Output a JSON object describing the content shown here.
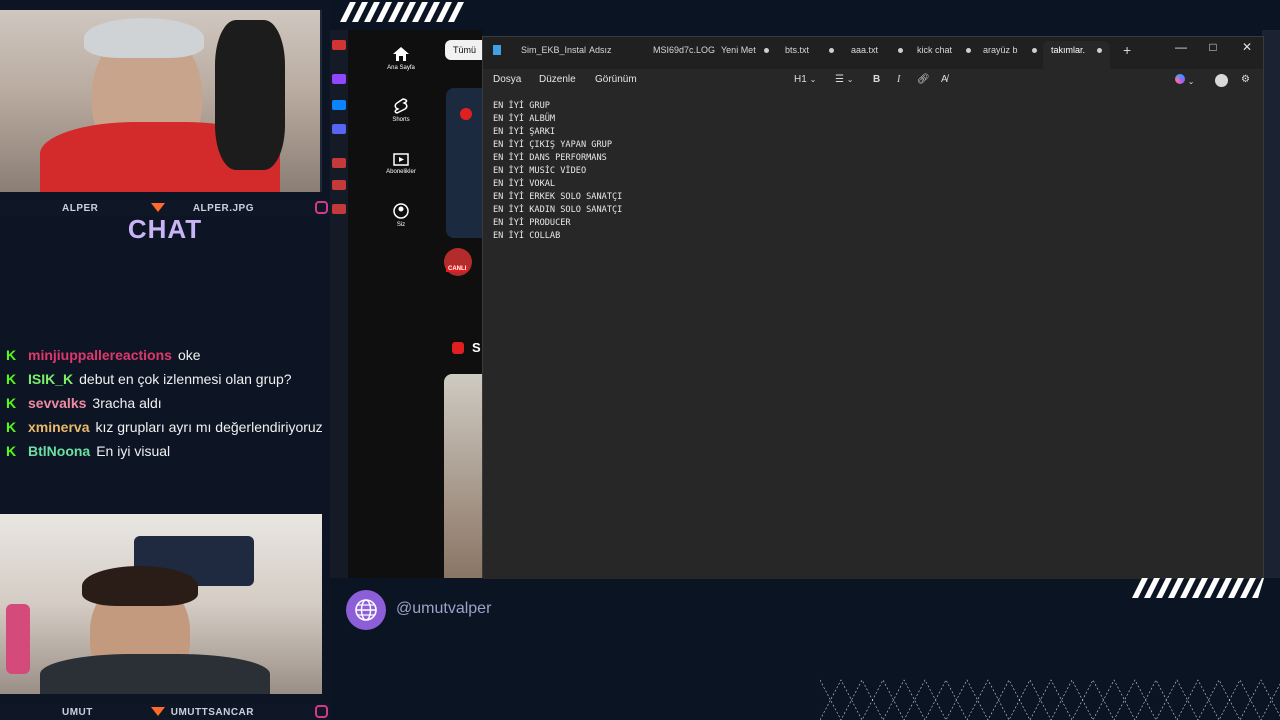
{
  "top_cam": {
    "left_name": "ALPER",
    "right_name": "ALPER.JPG"
  },
  "bottom_cam": {
    "left_name": "UMUT",
    "right_name": "UMUTTSANCAR"
  },
  "chat": {
    "title": "CHAT",
    "messages": [
      {
        "user": "minjiuppallereactions",
        "user_color": "#e0376b",
        "text": "oke"
      },
      {
        "user": "ISIK_K",
        "user_color": "#7bf06b",
        "text": "debut en çok izlenmesi olan grup?"
      },
      {
        "user": "sevvalks",
        "user_color": "#f08aa2",
        "text": "3racha aldı"
      },
      {
        "user": "xminerva",
        "user_color": "#e9b96a",
        "text": "kız grupları ayrı mı değerlendiriyoruz"
      },
      {
        "user": "BtlNoona",
        "user_color": "#6be0a4",
        "text": "En iyi visual"
      }
    ]
  },
  "youtube": {
    "chip": "Tümü",
    "nav": [
      {
        "label": "Ana Sayfa",
        "icon": "home-icon"
      },
      {
        "label": "Shorts",
        "icon": "shorts-icon"
      },
      {
        "label": "Abonelikler",
        "icon": "subscriptions-icon"
      },
      {
        "label": "Siz",
        "icon": "account-icon"
      }
    ],
    "live_badge": "CANLI",
    "section_letter": "S"
  },
  "notepad": {
    "tabs": [
      {
        "label": "Sim_EKB_Instal",
        "active": false
      },
      {
        "label": "Adsız",
        "active": false
      },
      {
        "label": "MSI69d7c.LOG",
        "active": false
      },
      {
        "label": "Yeni Met",
        "active": false
      },
      {
        "label": "bts.txt",
        "active": false
      },
      {
        "label": "aaa.txt",
        "active": false
      },
      {
        "label": "kick chat",
        "active": false
      },
      {
        "label": "arayüz b",
        "active": false
      },
      {
        "label": "takımlar.",
        "active": true
      }
    ],
    "new_tab": "+",
    "window_buttons": {
      "minimize": "—",
      "maximize": "□",
      "close": "✕"
    },
    "menu": [
      "Dosya",
      "Düzenle",
      "Görünüm"
    ],
    "toolbar": {
      "heading": "H1",
      "bold": "B",
      "italic": "I"
    },
    "lines": [
      "EN İYİ GRUP",
      "EN İYİ ALBÜM",
      "EN İYİ ŞARKI",
      "EN İYİ ÇIKIŞ YAPAN GRUP",
      "EN İYİ DANS PERFORMANS",
      "EN İYİ MUSİC VİDEO",
      "EN İYİ VOKAL",
      "EN İYİ ERKEK SOLO SANATÇI",
      "EN İYİ KADIN SOLO SANATÇI",
      "EN İYİ PRODUCER",
      "EN İYİ COLLAB"
    ]
  },
  "social": {
    "handle": "@umutvalper"
  },
  "colors": {
    "accent": "#ff6a2a",
    "chat_title": "#c9b4f5",
    "kick_green": "#53fc18",
    "social_purple": "#8c5ed8"
  }
}
